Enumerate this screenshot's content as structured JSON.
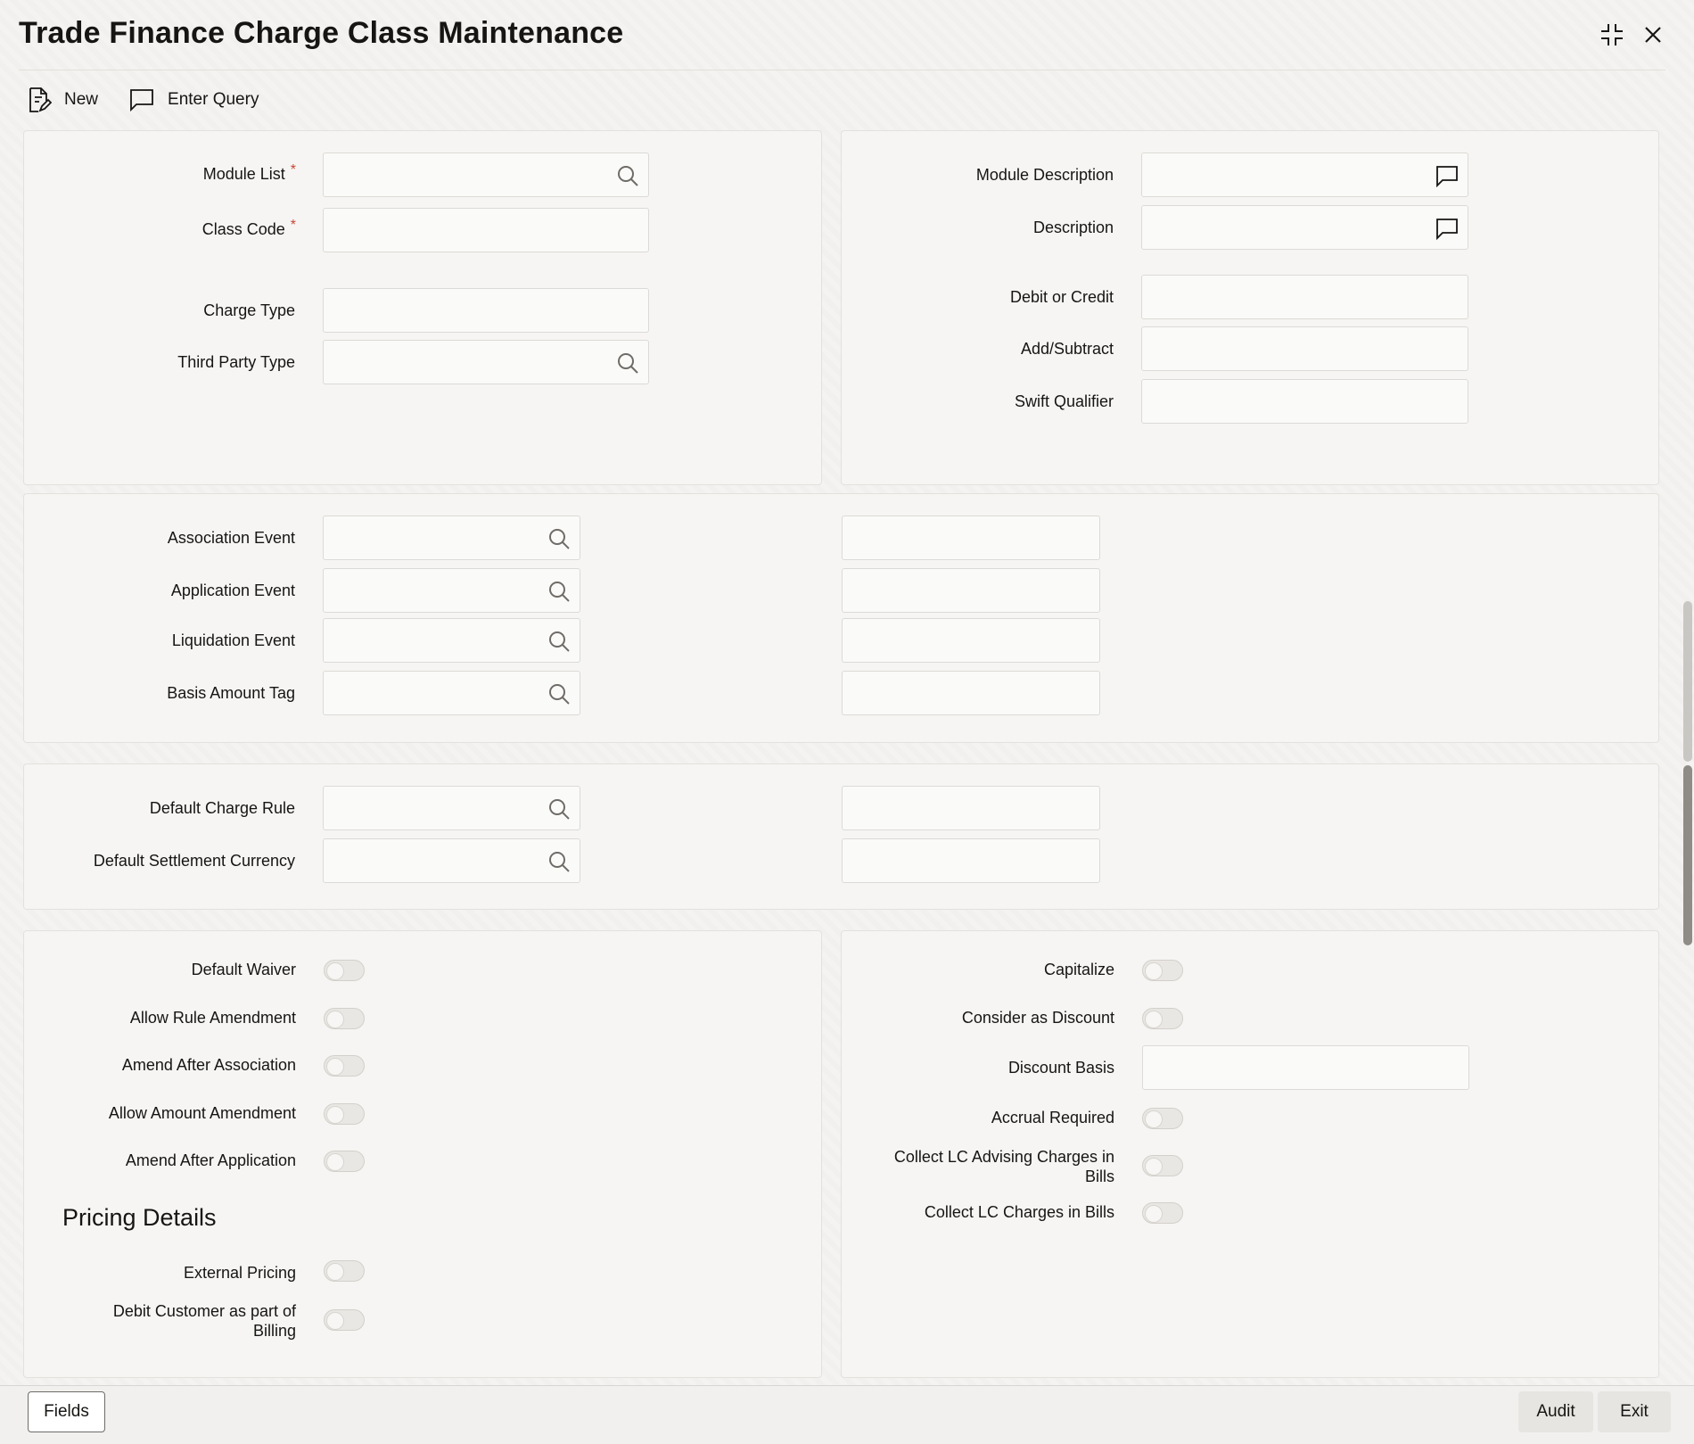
{
  "window": {
    "title": "Trade Finance Charge Class Maintenance"
  },
  "toolbar": {
    "new_label": "New",
    "enter_query_label": "Enter Query"
  },
  "header_left": {
    "module_list": "Module List",
    "class_code": "Class Code",
    "charge_type": "Charge Type",
    "third_party_type": "Third Party Type",
    "required_mark": "*"
  },
  "header_right": {
    "module_description": "Module Description",
    "description": "Description",
    "debit_or_credit": "Debit or Credit",
    "add_subtract": "Add/Subtract",
    "swift_qualifier": "Swift Qualifier"
  },
  "events": {
    "association_event": "Association Event",
    "application_event": "Application Event",
    "liquidation_event": "Liquidation Event",
    "basis_amount_tag": "Basis Amount Tag"
  },
  "defaults": {
    "default_charge_rule": "Default Charge Rule",
    "default_settlement_currency": "Default Settlement Currency"
  },
  "options_left": {
    "default_waiver": "Default Waiver",
    "allow_rule_amendment": "Allow Rule Amendment",
    "amend_after_association": "Amend After Association",
    "allow_amount_amendment": "Allow Amount Amendment",
    "amend_after_application": "Amend After Application",
    "pricing_details": "Pricing Details",
    "external_pricing": "External Pricing",
    "debit_customer_line1": "Debit Customer as part of",
    "debit_customer_line2": "Billing"
  },
  "options_right": {
    "capitalize": "Capitalize",
    "consider_as_discount": "Consider as Discount",
    "discount_basis": "Discount Basis",
    "accrual_required": "Accrual Required",
    "collect_lc_advising_line1": "Collect LC Advising Charges in",
    "collect_lc_advising_line2": "Bills",
    "collect_lc_charges": "Collect LC Charges in Bills"
  },
  "footer": {
    "fields_label": "Fields",
    "audit_label": "Audit",
    "exit_label": "Exit"
  },
  "colors": {
    "required": "#c74634",
    "text": "#161513",
    "panel_bg": "#f6f5f3"
  }
}
